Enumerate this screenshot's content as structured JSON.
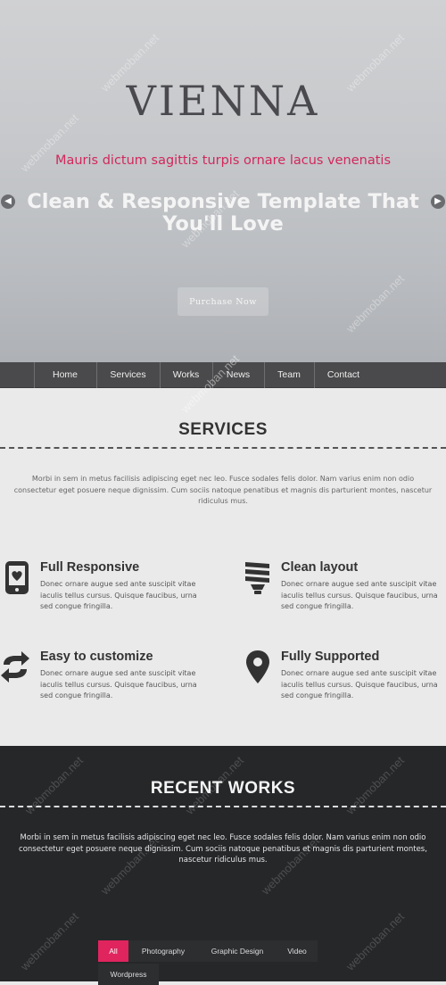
{
  "hero": {
    "logo": "VIENNA",
    "tagline": "Mauris dictum sagittis turpis ornare lacus venenatis",
    "headline": "Clean & Responsive Template That You'll Love",
    "cta": "Purchase Now",
    "prev_icon": "chevron-left",
    "next_icon": "chevron-right"
  },
  "nav": {
    "items": [
      "Home",
      "Services",
      "Works",
      "News",
      "Team",
      "Contact"
    ]
  },
  "services": {
    "title": "SERVICES",
    "description": "Morbi in sem in metus facilisis adipiscing eget nec leo. Fusce sodales felis dolor. Nam varius enim non odio consectetur eget posuere neque dignissim. Cum sociis natoque penatibus et magnis dis parturient montes, nascetur ridiculus mus.",
    "features": [
      {
        "title": "Full Responsive",
        "icon": "mobile-icon",
        "text": "Donec ornare augue sed ante suscipit vitae iaculis tellus cursus. Quisque faucibus, urna sed congue fringilla."
      },
      {
        "title": "Clean layout",
        "icon": "lightbulb-icon",
        "text": "Donec ornare augue sed ante suscipit vitae iaculis tellus cursus. Quisque faucibus, urna sed congue fringilla."
      },
      {
        "title": "Easy to customize",
        "icon": "refresh-icon",
        "text": "Donec ornare augue sed ante suscipit vitae iaculis tellus cursus. Quisque faucibus, urna sed congue fringilla."
      },
      {
        "title": "Fully Supported",
        "icon": "map-pin-icon",
        "text": "Donec ornare augue sed ante suscipit vitae iaculis tellus cursus. Quisque faucibus, urna sed congue fringilla."
      }
    ]
  },
  "works": {
    "title": "RECENT WORKS",
    "description": "Morbi in sem in metus facilisis adipiscing eget nec leo. Fusce sodales felis dolor. Nam varius enim non odio consectetur eget posuere neque dignissim. Cum sociis natoque penatibus et magnis dis parturient montes, nascetur ridiculus mus.",
    "filters": [
      "All",
      "Photography",
      "Graphic Design",
      "Video",
      "Wordpress"
    ],
    "active_filter": "All"
  },
  "watermark": "webmoban.net",
  "colors": {
    "accent": "#e0245e",
    "tagline": "#d1285b",
    "nav_bg": "#4a4a4c",
    "works_bg": "#252729",
    "services_bg": "#eaeaea"
  }
}
